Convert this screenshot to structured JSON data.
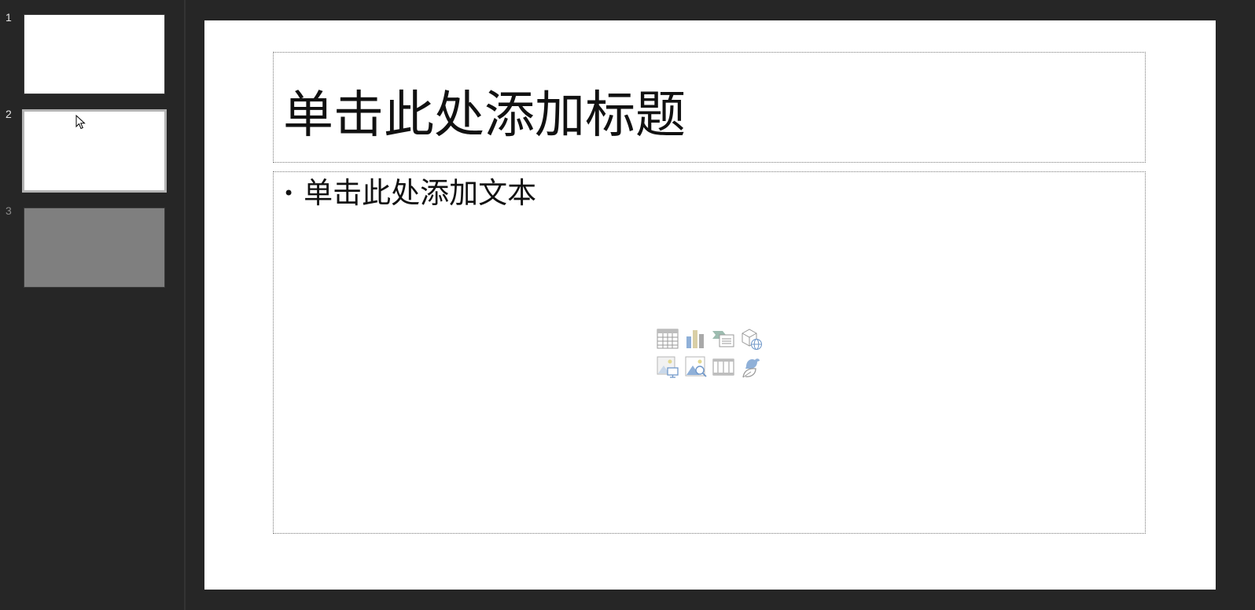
{
  "thumbnails": [
    {
      "number": "1",
      "hidden": false,
      "selected": false
    },
    {
      "number": "2",
      "hidden": false,
      "selected": true
    },
    {
      "number": "3",
      "hidden": true,
      "selected": false
    }
  ],
  "slide": {
    "title_placeholder": "单击此处添加标题",
    "body_placeholder": "单击此处添加文本",
    "bullet": "•"
  },
  "insert_icons": [
    "insert-table-icon",
    "insert-chart-icon",
    "insert-smartart-icon",
    "insert-3d-model-icon",
    "insert-picture-icon",
    "insert-stock-image-icon",
    "insert-video-icon",
    "insert-icons-icon"
  ],
  "colors": {
    "background": "#262626",
    "slide": "#ffffff",
    "hidden_thumb": "#7f7f7f",
    "selected_border": "#b3b3b3",
    "icon_blue": "#8fb0d8",
    "icon_tan": "#d9cfa6",
    "icon_gray": "#9a9a9a"
  }
}
